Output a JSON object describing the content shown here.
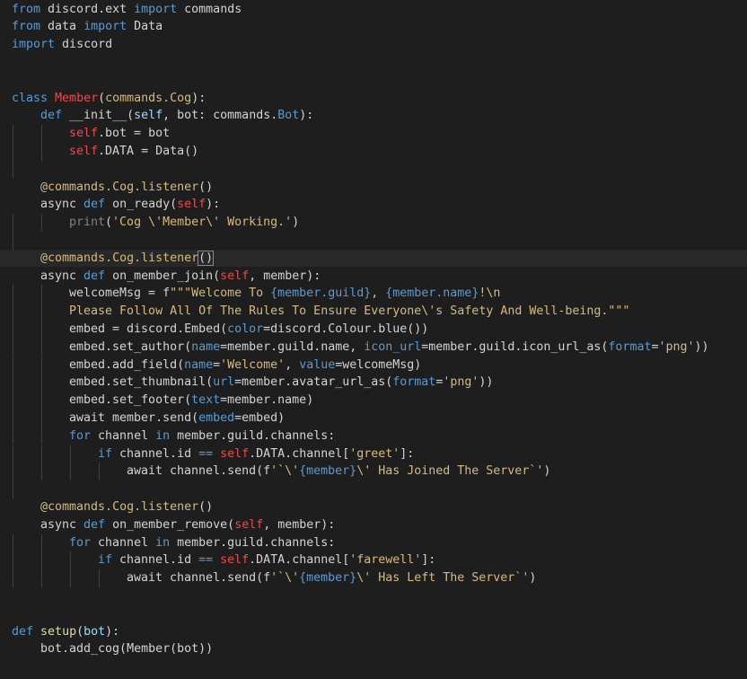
{
  "editor": {
    "language": "python",
    "theme_colors": {
      "background": "#1e1e1e",
      "current_line": "#282828",
      "keyword": "#569cd6",
      "class_name": "#f44747",
      "string": "#ce9178",
      "decorator": "#d7ba7d",
      "parameter": "#9cdcfe",
      "plain": "#d4d4d4"
    },
    "lines": [
      {
        "indent": 0,
        "tokens": [
          [
            "kw",
            "from"
          ],
          [
            "plain",
            " discord.ext "
          ],
          [
            "kw",
            "import"
          ],
          [
            "plain",
            " commands"
          ]
        ]
      },
      {
        "indent": 0,
        "tokens": [
          [
            "kw",
            "from"
          ],
          [
            "plain",
            " data "
          ],
          [
            "kw",
            "import"
          ],
          [
            "plain",
            " Data"
          ]
        ]
      },
      {
        "indent": 0,
        "tokens": [
          [
            "kw",
            "import"
          ],
          [
            "plain",
            " discord"
          ]
        ]
      },
      {
        "indent": 0,
        "tokens": []
      },
      {
        "indent": 0,
        "tokens": []
      },
      {
        "indent": 0,
        "tokens": [
          [
            "kw",
            "class"
          ],
          [
            "plain",
            " "
          ],
          [
            "cls",
            "Member"
          ],
          [
            "plain",
            "("
          ],
          [
            "deco",
            "commands.Cog"
          ],
          [
            "plain",
            "):"
          ]
        ]
      },
      {
        "indent": 1,
        "tokens": [
          [
            "kw",
            "def"
          ],
          [
            "plain",
            " __init__("
          ],
          [
            "param",
            "self"
          ],
          [
            "plain",
            ", bot: commands."
          ],
          [
            "kw",
            "Bot"
          ],
          [
            "plain",
            "):"
          ]
        ]
      },
      {
        "indent": 2,
        "tokens": [
          [
            "self",
            "self"
          ],
          [
            "plain",
            ".bot = bot"
          ]
        ]
      },
      {
        "indent": 2,
        "tokens": [
          [
            "self",
            "self"
          ],
          [
            "plain",
            ".DATA = Data()"
          ]
        ]
      },
      {
        "indent": 1,
        "tokens": []
      },
      {
        "indent": 1,
        "tokens": [
          [
            "deco",
            "@"
          ],
          [
            "deco",
            "commands.Cog.listener"
          ],
          [
            "plain",
            "()"
          ]
        ]
      },
      {
        "indent": 1,
        "tokens": [
          [
            "plain",
            "async "
          ],
          [
            "kw",
            "def"
          ],
          [
            "plain",
            " on_ready("
          ],
          [
            "self",
            "self"
          ],
          [
            "plain",
            "):"
          ]
        ]
      },
      {
        "indent": 2,
        "tokens": [
          [
            "dim",
            "print"
          ],
          [
            "plain",
            "("
          ],
          [
            "strdef",
            "'Cog \\'Member\\' Working.'"
          ],
          [
            "plain",
            ")"
          ]
        ]
      },
      {
        "indent": 1,
        "tokens": []
      },
      {
        "indent": 1,
        "current": true,
        "tokens": [
          [
            "deco",
            "@"
          ],
          [
            "deco",
            "commands.Cog.listener"
          ],
          [
            "match",
            "()"
          ]
        ]
      },
      {
        "indent": 1,
        "tokens": [
          [
            "plain",
            "async "
          ],
          [
            "kw",
            "def"
          ],
          [
            "plain",
            " on_member_join("
          ],
          [
            "self",
            "self"
          ],
          [
            "plain",
            ", member):"
          ]
        ]
      },
      {
        "indent": 2,
        "tokens": [
          [
            "plain",
            "welcomeMsg = f"
          ],
          [
            "strdef",
            "\"\"\"Welcome To "
          ],
          [
            "brace",
            "{member.guild}"
          ],
          [
            "strdef",
            ", "
          ],
          [
            "brace",
            "{member.name}"
          ],
          [
            "strdef",
            "!\\n"
          ]
        ]
      },
      {
        "indent": 2,
        "tokens": [
          [
            "strdef",
            "Please Follow All Of The Rules To Ensure Everyone"
          ],
          [
            "esc",
            "\\'"
          ],
          [
            "strdef",
            "s Safety And Well-being.\"\"\""
          ]
        ]
      },
      {
        "indent": 2,
        "tokens": [
          [
            "plain",
            "embed = discord.Embed("
          ],
          [
            "kw",
            "color"
          ],
          [
            "plain",
            "=discord.Colour.blue())"
          ]
        ]
      },
      {
        "indent": 2,
        "tokens": [
          [
            "plain",
            "embed.set_author("
          ],
          [
            "kw",
            "name"
          ],
          [
            "plain",
            "=member.guild.name, "
          ],
          [
            "kw",
            "icon_url"
          ],
          [
            "plain",
            "=member.guild.icon_url_as("
          ],
          [
            "kw",
            "format"
          ],
          [
            "plain",
            "="
          ],
          [
            "strdef",
            "'png'"
          ],
          [
            "plain",
            "))"
          ]
        ]
      },
      {
        "indent": 2,
        "tokens": [
          [
            "plain",
            "embed.add_field("
          ],
          [
            "kw",
            "name"
          ],
          [
            "plain",
            "="
          ],
          [
            "strdef",
            "'Welcome'"
          ],
          [
            "plain",
            ", "
          ],
          [
            "kw",
            "value"
          ],
          [
            "plain",
            "=welcomeMsg)"
          ]
        ]
      },
      {
        "indent": 2,
        "tokens": [
          [
            "plain",
            "embed.set_thumbnail("
          ],
          [
            "kw",
            "url"
          ],
          [
            "plain",
            "=member.avatar_url_as("
          ],
          [
            "kw",
            "format"
          ],
          [
            "plain",
            "="
          ],
          [
            "strdef",
            "'png'"
          ],
          [
            "plain",
            "))"
          ]
        ]
      },
      {
        "indent": 2,
        "tokens": [
          [
            "plain",
            "embed.set_footer("
          ],
          [
            "kw",
            "text"
          ],
          [
            "plain",
            "=member.name)"
          ]
        ]
      },
      {
        "indent": 2,
        "tokens": [
          [
            "plain",
            "await member.send("
          ],
          [
            "kw",
            "embed"
          ],
          [
            "plain",
            "=embed)"
          ]
        ]
      },
      {
        "indent": 2,
        "tokens": [
          [
            "kw",
            "for"
          ],
          [
            "plain",
            " channel "
          ],
          [
            "kw",
            "in"
          ],
          [
            "plain",
            " member.guild.channels:"
          ]
        ]
      },
      {
        "indent": 3,
        "tokens": [
          [
            "kw",
            "if"
          ],
          [
            "plain",
            " channel.id "
          ],
          [
            "kw",
            "=="
          ],
          [
            "plain",
            " "
          ],
          [
            "self",
            "self"
          ],
          [
            "plain",
            ".DATA.channel["
          ],
          [
            "strdef",
            "'greet'"
          ],
          [
            "plain",
            "]:"
          ]
        ]
      },
      {
        "indent": 4,
        "tokens": [
          [
            "plain",
            "await channel.send(f"
          ],
          [
            "strdef",
            "'`"
          ],
          [
            "esc",
            "\\'"
          ],
          [
            "brace",
            "{member}"
          ],
          [
            "esc",
            "\\'"
          ],
          [
            "strdef",
            " Has Joined The Server`'"
          ],
          [
            "plain",
            ")"
          ]
        ]
      },
      {
        "indent": 1,
        "tokens": []
      },
      {
        "indent": 1,
        "tokens": [
          [
            "deco",
            "@"
          ],
          [
            "deco",
            "commands.Cog.listener"
          ],
          [
            "plain",
            "()"
          ]
        ]
      },
      {
        "indent": 1,
        "tokens": [
          [
            "plain",
            "async "
          ],
          [
            "kw",
            "def"
          ],
          [
            "plain",
            " on_member_remove("
          ],
          [
            "self",
            "self"
          ],
          [
            "plain",
            ", member):"
          ]
        ]
      },
      {
        "indent": 2,
        "tokens": [
          [
            "kw",
            "for"
          ],
          [
            "plain",
            " channel "
          ],
          [
            "kw",
            "in"
          ],
          [
            "plain",
            " member.guild.channels:"
          ]
        ]
      },
      {
        "indent": 3,
        "tokens": [
          [
            "kw",
            "if"
          ],
          [
            "plain",
            " channel.id "
          ],
          [
            "kw",
            "=="
          ],
          [
            "plain",
            " "
          ],
          [
            "self",
            "self"
          ],
          [
            "plain",
            ".DATA.channel["
          ],
          [
            "strdef",
            "'farewell'"
          ],
          [
            "plain",
            "]:"
          ]
        ]
      },
      {
        "indent": 4,
        "tokens": [
          [
            "plain",
            "await channel.send(f"
          ],
          [
            "strdef",
            "'`"
          ],
          [
            "esc",
            "\\'"
          ],
          [
            "brace",
            "{member}"
          ],
          [
            "esc",
            "\\'"
          ],
          [
            "strdef",
            " Has Left The Server`'"
          ],
          [
            "plain",
            ")"
          ]
        ]
      },
      {
        "indent": 0,
        "tokens": []
      },
      {
        "indent": 0,
        "tokens": []
      },
      {
        "indent": 0,
        "tokens": [
          [
            "kw",
            "def"
          ],
          [
            "plain",
            " "
          ],
          [
            "fn",
            "setup"
          ],
          [
            "plain",
            "("
          ],
          [
            "param",
            "bot"
          ],
          [
            "plain",
            "):"
          ]
        ]
      },
      {
        "indent": 1,
        "tokens": [
          [
            "plain",
            "bot.add_cog(Member(bot))"
          ]
        ]
      }
    ]
  }
}
